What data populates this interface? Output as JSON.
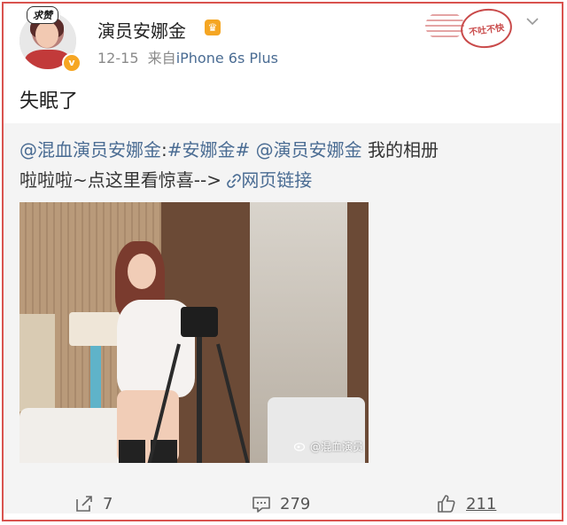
{
  "post": {
    "author": {
      "badge": "求赞",
      "name": "演员安娜金",
      "verified_mark": "v"
    },
    "timestamp": "12-15",
    "source_prefix": "来自",
    "source": "iPhone 6s Plus",
    "stamp_text": "不吐不快",
    "status_text": "失眠了",
    "repost": {
      "line1_mention": "@混血演员安娜金",
      "line1_sep": ":",
      "line1_topic": "#安娜金#",
      "line1_mention2": "@演员安娜金",
      "line1_rest": " 我的相册",
      "line2_text": "啦啦啦~点这里看惊喜--> ",
      "link_label": "网页链接",
      "image_watermark": "@混血演员"
    },
    "actions": {
      "forward_count": "7",
      "comment_count": "279",
      "like_count": "211"
    }
  },
  "icons": {
    "chevron": "chevron-down-icon",
    "forward": "forward-icon",
    "comment": "comment-icon",
    "like": "thumbs-up-icon",
    "link": "link-icon",
    "weibo": "weibo-icon"
  },
  "colors": {
    "link": "#4a6c93",
    "border": "#d9534f",
    "repost_bg": "#f4f4f4",
    "verified": "#f6a623"
  }
}
